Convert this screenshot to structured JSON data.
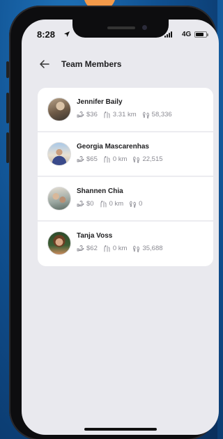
{
  "status_bar": {
    "time": "8:28",
    "network": "4G"
  },
  "header": {
    "title": "Team Members"
  },
  "members": [
    {
      "name": "Jennifer Baily",
      "earnings": "$36",
      "distance": "3.31 km",
      "steps": "58,336"
    },
    {
      "name": "Georgia Mascarenhas",
      "earnings": "$65",
      "distance": "0 km",
      "steps": "22,515"
    },
    {
      "name": "Shannen Chia",
      "earnings": "$0",
      "distance": "0 km",
      "steps": "0"
    },
    {
      "name": "Tanja Voss",
      "earnings": "$62",
      "distance": "0 km",
      "steps": "35,688"
    }
  ],
  "icons": {
    "back": "arrow-left-icon",
    "earnings": "hand-money-icon",
    "distance": "route-icon",
    "steps": "footprints-icon"
  },
  "colors": {
    "background": "#0f4f8f",
    "screen": "#e9e9ee",
    "accent": "#f39a4a"
  }
}
